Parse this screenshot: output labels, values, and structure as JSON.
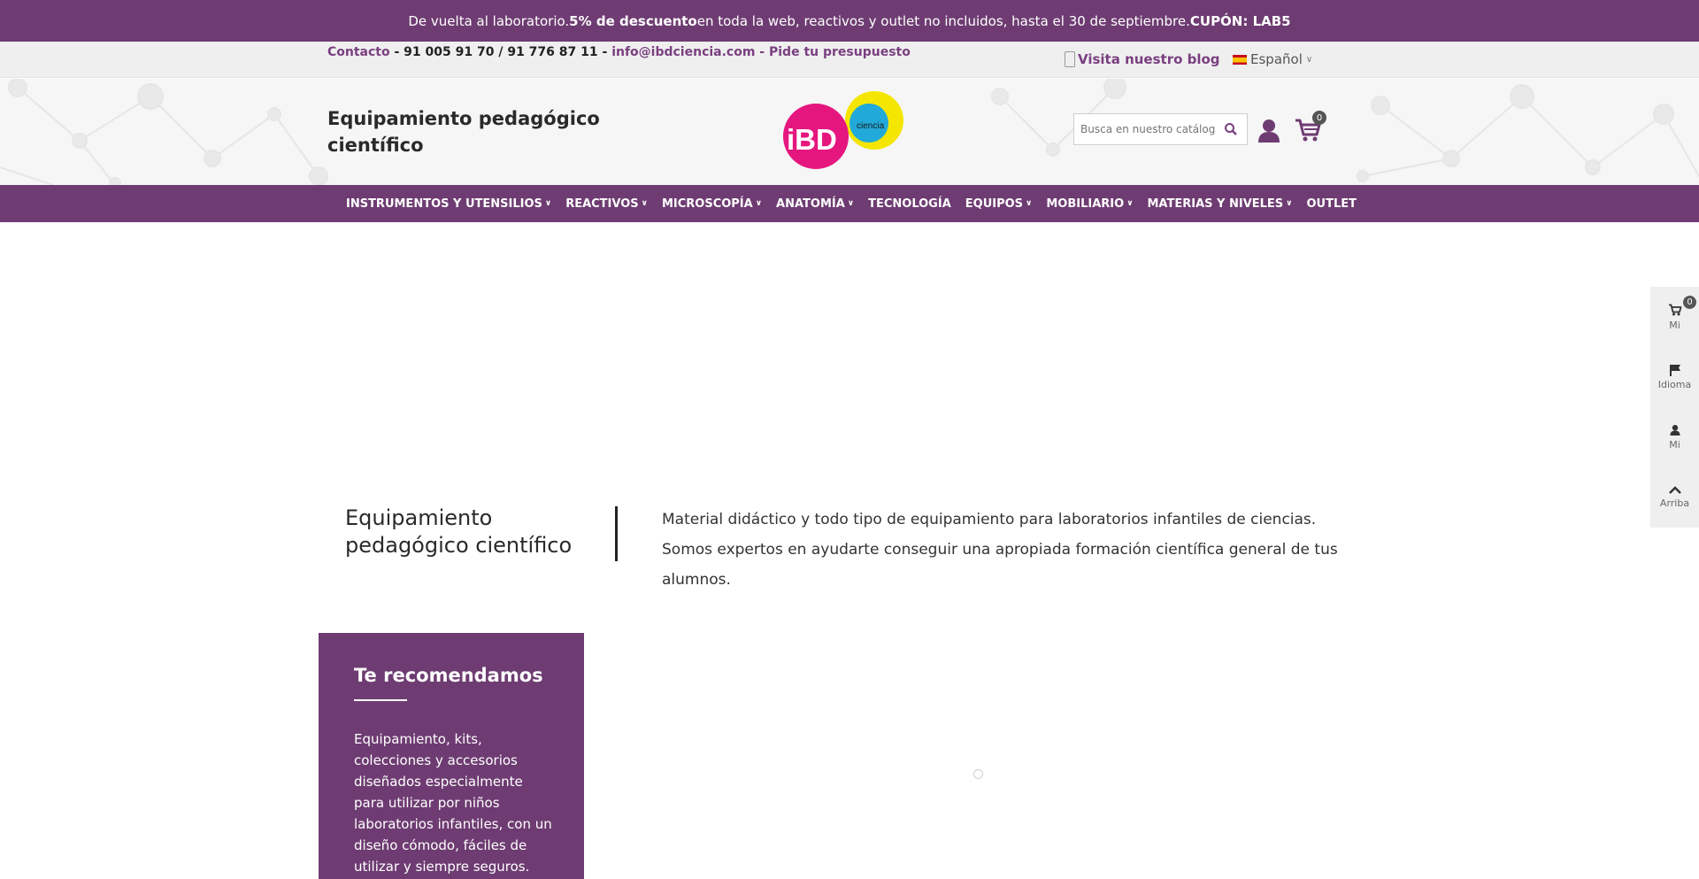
{
  "promo": {
    "part1": "De vuelta al laboratorio. ",
    "bold1": "5% de descuento",
    "part2": " en toda la web, reactivos y outlet no incluidos, hasta el 30 de septiembre. ",
    "bold2": "CUPÓN: LAB5"
  },
  "topbar": {
    "contact_label": "Contacto",
    "sep1": " - ",
    "phones": "91 005 91 70 / 91 776 87 11",
    "sep2": " - ",
    "email": "info@ibdciencia.com",
    "sep3": " - ",
    "quote": "Pide tu presupuesto",
    "blog": "Visita nuestro blog",
    "language": "Español"
  },
  "header": {
    "tagline": "Equipamiento pedagógico científico",
    "logo_text": "iBD",
    "logo_subtext": "ciencia",
    "search_placeholder": "Busca en nuestro catálogo",
    "cart_count": "0"
  },
  "nav": {
    "items": [
      {
        "label": "INSTRUMENTOS Y UTENSILIOS",
        "dropdown": "true"
      },
      {
        "label": "REACTIVOS",
        "dropdown": "true"
      },
      {
        "label": "MICROSCOPÍA",
        "dropdown": "true"
      },
      {
        "label": "ANATOMÍA",
        "dropdown": "true"
      },
      {
        "label": "TECNOLOGÍA",
        "dropdown": ""
      },
      {
        "label": "EQUIPOS",
        "dropdown": "true"
      },
      {
        "label": "MOBILIARIO",
        "dropdown": "true"
      },
      {
        "label": "MATERIAS Y NIVELES",
        "dropdown": "true"
      },
      {
        "label": "OUTLET",
        "dropdown": ""
      }
    ]
  },
  "intro": {
    "title": "Equipamiento pedagógico científico",
    "text": "Material didáctico y todo tipo de equipamiento para laboratorios infantiles de ciencias. Somos expertos en ayudarte conseguir una apropiada formación científica general de tus alumnos."
  },
  "recommend": {
    "title": "Te recomendamos",
    "text": "Equipamiento, kits, colecciones y accesorios diseñados especialmente para utilizar por niños laboratorios infantiles, con un diseño cómodo, fáciles de utilizar y siempre seguros."
  },
  "sticky": {
    "cart_label": "Mi",
    "cart_count": "0",
    "language_label": "Idioma",
    "account_label": "Mi",
    "top_label": "Arriba"
  },
  "colors": {
    "brand_purple": "#6e3c72",
    "logo_magenta": "#e5177f",
    "logo_yellow": "#f4e600",
    "logo_cyan": "#21a9d9"
  }
}
